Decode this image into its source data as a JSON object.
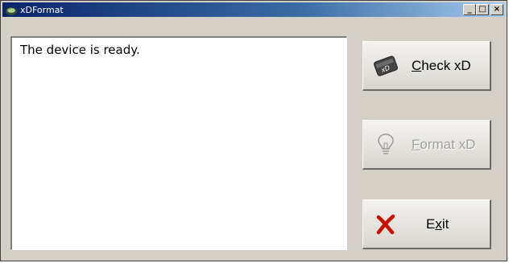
{
  "window": {
    "title": "xDFormat"
  },
  "title_controls": {
    "minimize": "_",
    "maximize": "□",
    "close": "×"
  },
  "status": {
    "message": "The device is ready."
  },
  "buttons": {
    "check": {
      "mnemonic": "C",
      "rest": "heck xD",
      "enabled": true,
      "icon": "xd-card-icon"
    },
    "format": {
      "mnemonic": "F",
      "rest": "ormat xD",
      "enabled": false,
      "icon": "lightbulb-icon"
    },
    "exit": {
      "pre": "E",
      "mnemonic": "x",
      "rest": "it",
      "enabled": true,
      "icon": "red-x-icon"
    }
  },
  "colors": {
    "titlebar_start": "#0a246a",
    "titlebar_end": "#a6caf0",
    "face": "#d4d0c8",
    "exit_icon": "#cc1100"
  }
}
